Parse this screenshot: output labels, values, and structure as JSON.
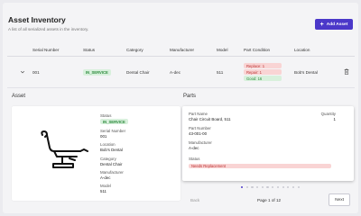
{
  "header": {
    "title": "Asset Inventory",
    "subtitle": "A list of all serialized assets in the inventory.",
    "add_button": "Add Asset"
  },
  "table": {
    "columns": [
      "Serial Number",
      "Status",
      "Category",
      "Manufacturer",
      "Model",
      "Part Condition",
      "Location"
    ],
    "rows": [
      {
        "serial": "001",
        "status": "IN_SERVICE",
        "category": "Dental Chair",
        "manufacturer": "A-dec",
        "model": "511",
        "conditions": [
          "Replace: 1",
          "Repair: 1",
          "Good: 16"
        ],
        "location": "Bob's Dental"
      }
    ]
  },
  "asset": {
    "heading": "Asset",
    "status_label": "Status",
    "status": "IN_SERVICE",
    "serial_label": "Serial Number",
    "serial": "001",
    "location_label": "Location",
    "location": "Bob's Dental",
    "category_label": "Category",
    "category": "Dental Chair",
    "manufacturer_label": "Manufacturer",
    "manufacturer": "A-dec",
    "model_label": "Model",
    "model": "511"
  },
  "parts": {
    "heading": "Parts",
    "part_name_label": "Part Name",
    "part_name": "Chair Circuit Board, 511",
    "quantity_label": "Quantity",
    "quantity": "1",
    "part_number_label": "Part Number",
    "part_number": "43-001-00",
    "manufacturer_label": "Manufacturer",
    "manufacturer": "A-dec",
    "status_label": "Status",
    "status": "Needs Replacement"
  },
  "pagination": {
    "back": "Back",
    "page_info": "Page 1 of 12",
    "next": "Next",
    "total_dots": 12,
    "active_dot": 1
  },
  "colors": {
    "accent": "#4b38c9",
    "good": "#2e8b3e",
    "bad": "#b33333"
  }
}
